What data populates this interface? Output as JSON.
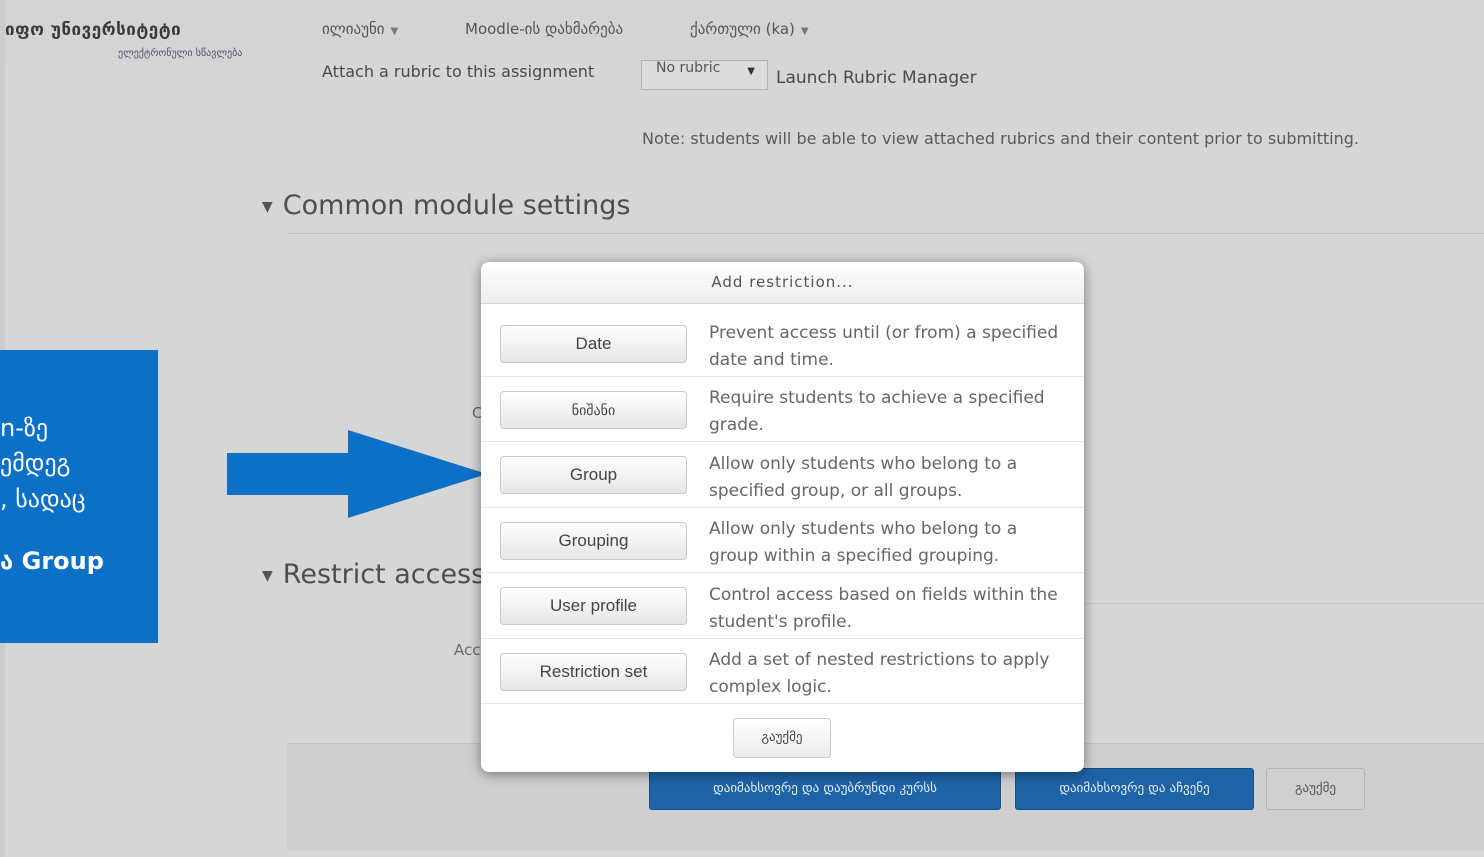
{
  "header": {
    "brand": "იფო უნივერსიტეტი",
    "brand_sub": "ელექტრონული სწავლება",
    "nav": [
      {
        "label": "ილიაუნი",
        "has_menu": true
      },
      {
        "label": "Moodle-ის დახმარება",
        "has_menu": false
      },
      {
        "label": "ქართული (ka)",
        "has_menu": true
      }
    ]
  },
  "grading": {
    "rubric_label": "Attach a rubric to this assignment",
    "rubric_select_value": "No rubric",
    "rubric_link": "Launch Rubric Manager",
    "note": "Note: students will be able to view attached rubrics and their content prior to submitting."
  },
  "sections": {
    "common_module": "Common module settings",
    "restrict_access": "Restrict access",
    "ghost_c": "C",
    "ghost_acc": "Acc"
  },
  "modal": {
    "title": "Add restriction...",
    "options": [
      {
        "button": "Date",
        "description": "Prevent access until (or from) a specified date and time."
      },
      {
        "button": "ნიშანი",
        "description": "Require students to achieve a specified grade."
      },
      {
        "button": "Group",
        "description": "Allow only students who belong to a specified group, or all groups."
      },
      {
        "button": "Grouping",
        "description": "Allow only students who belong to a group within a specified grouping."
      },
      {
        "button": "User profile",
        "description": "Control access based on fields within the student's profile."
      },
      {
        "button": "Restriction set",
        "description": "Add a set of nested restrictions to apply complex logic."
      }
    ],
    "cancel": "გაუქმე"
  },
  "footer": {
    "save_return": "დაიმახსოვრე და დაუბრუნდი კურსს",
    "save_display": "დაიმახსოვრე და აჩვენე",
    "cancel": "გაუქმე"
  },
  "callout": {
    "line1": "n-ზე",
    "line2": "ემდეგ",
    "line3": ", სადაც",
    "line4": "ა Group",
    "bg_color": "#0b70c6"
  },
  "arrow": {
    "color": "#0b70c6",
    "icon": "right-arrow-icon"
  }
}
